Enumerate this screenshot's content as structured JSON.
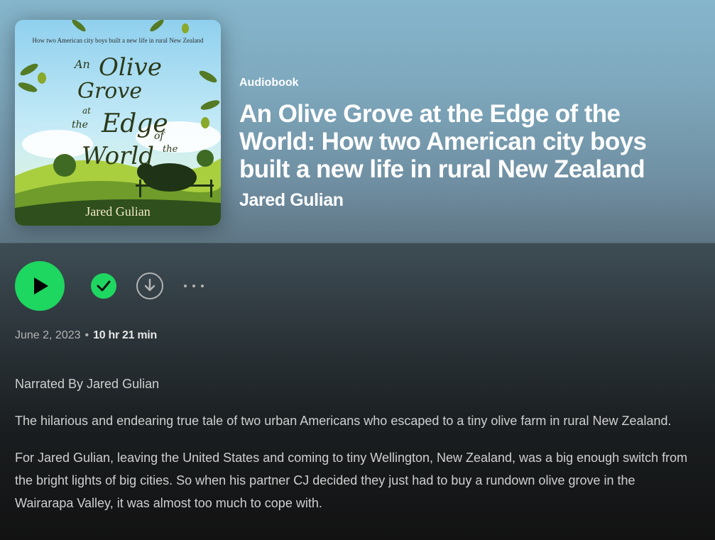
{
  "cover": {
    "tagline": "How two American city boys built a new life in rural New Zealand",
    "title_lines": [
      "An",
      "Olive",
      "Grove",
      "at",
      "the",
      "Edge",
      "of",
      "the",
      "World"
    ],
    "author": "Jared Gulian"
  },
  "header": {
    "kind": "Audiobook",
    "title": "An Olive Grove at the Edge of the World: How two American city boys built a new life in rural New Zealand",
    "author": "Jared Gulian"
  },
  "meta": {
    "date": "June 2, 2023",
    "separator": "•",
    "duration": "10 hr 21 min"
  },
  "description": {
    "narrated_by": "Narrated By Jared Gulian",
    "paragraphs": [
      "The hilarious and endearing true tale of two urban Americans who escaped to a tiny olive farm in rural New Zealand.",
      "For Jared Gulian, leaving the United States and coming to tiny Wellington, New Zealand, was a big enough switch from the bright lights of big cities. So when his partner CJ decided they just had to buy a rundown olive grove in the Wairarapa Valley, it was almost too much to cope with."
    ]
  },
  "colors": {
    "accent": "#1ed760",
    "muted": "#b3b3b3",
    "background": "#121212"
  },
  "icons": [
    "play-icon",
    "check-icon",
    "download-icon",
    "more-icon"
  ]
}
